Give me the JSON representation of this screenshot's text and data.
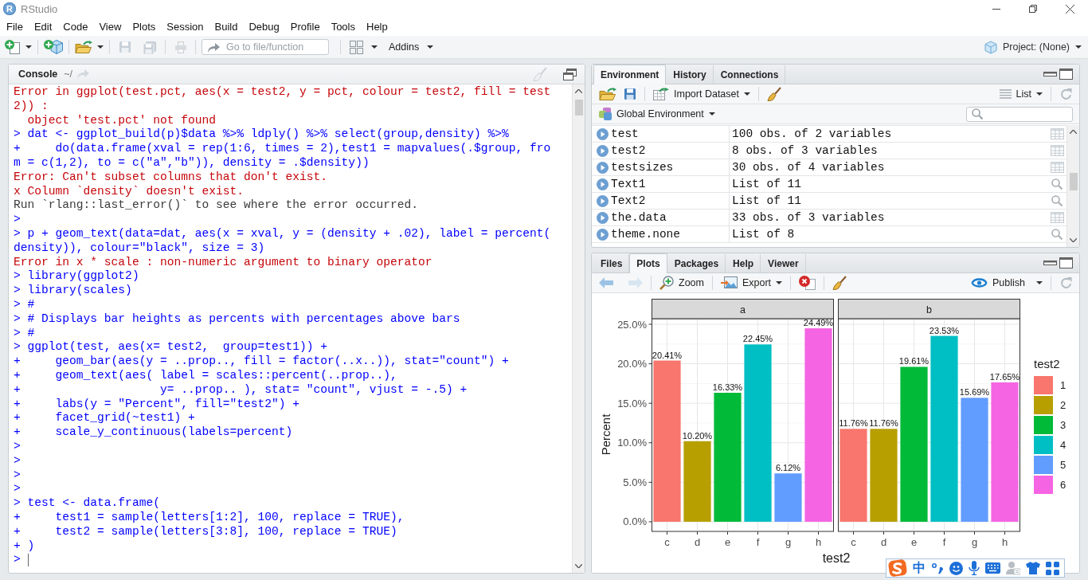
{
  "window": {
    "icon_letter": "R",
    "title": "RStudio"
  },
  "menu": [
    "File",
    "Edit",
    "Code",
    "View",
    "Plots",
    "Session",
    "Build",
    "Debug",
    "Profile",
    "Tools",
    "Help"
  ],
  "toolbar": {
    "go_to": {
      "placeholder": "Go to file/function"
    },
    "addins": "Addins",
    "project": "Project: (None)"
  },
  "console": {
    "title": "Console",
    "path": "~/",
    "lines": [
      {
        "kind": "error",
        "text": "Error in ggplot(test.pct, aes(x = test2, y = pct, colour = test2, fill = test"
      },
      {
        "kind": "error",
        "text": "2)) :"
      },
      {
        "kind": "error",
        "text": "  object 'test.pct' not found"
      },
      {
        "kind": "input",
        "text": "> dat <- ggplot_build(p)$data %>% ldply() %>% select(group,density) %>%"
      },
      {
        "kind": "input",
        "text": "+     do(data.frame(xval = rep(1:6, times = 2),test1 = mapvalues(.$group, fro"
      },
      {
        "kind": "input",
        "text": "m = c(1,2), to = c(\"a\",\"b\")), density = .$density))"
      },
      {
        "kind": "error",
        "text": "Error: Can't subset columns that don't exist."
      },
      {
        "kind": "error",
        "text": "x Column `density` doesn't exist."
      },
      {
        "kind": "output",
        "text": "Run `rlang::last_error()` to see where the error occurred."
      },
      {
        "kind": "input",
        "text": ">"
      },
      {
        "kind": "input",
        "text": "> p + geom_text(data=dat, aes(x = xval, y = (density + .02), label = percent("
      },
      {
        "kind": "input",
        "text": "density)), colour=\"black\", size = 3)"
      },
      {
        "kind": "error",
        "text": "Error in x * scale : non-numeric argument to binary operator"
      },
      {
        "kind": "input",
        "text": "> library(ggplot2)"
      },
      {
        "kind": "input",
        "text": "> library(scales)"
      },
      {
        "kind": "input",
        "text": "> #"
      },
      {
        "kind": "input",
        "text": "> # Displays bar heights as percents with percentages above bars"
      },
      {
        "kind": "input",
        "text": "> #"
      },
      {
        "kind": "input",
        "text": "> ggplot(test, aes(x= test2,  group=test1)) +"
      },
      {
        "kind": "input",
        "text": "+     geom_bar(aes(y = ..prop.., fill = factor(..x..)), stat=\"count\") +"
      },
      {
        "kind": "input",
        "text": "+     geom_text(aes( label = scales::percent(..prop..),"
      },
      {
        "kind": "input",
        "text": "+                    y= ..prop.. ), stat= \"count\", vjust = -.5) +"
      },
      {
        "kind": "input",
        "text": "+     labs(y = \"Percent\", fill=\"test2\") +"
      },
      {
        "kind": "input",
        "text": "+     facet_grid(~test1) +"
      },
      {
        "kind": "input",
        "text": "+     scale_y_continuous(labels=percent)"
      },
      {
        "kind": "input",
        "text": ">"
      },
      {
        "kind": "input",
        "text": ">"
      },
      {
        "kind": "input",
        "text": ">"
      },
      {
        "kind": "input",
        "text": ">"
      },
      {
        "kind": "input",
        "text": "> test <- data.frame("
      },
      {
        "kind": "input",
        "text": "+     test1 = sample(letters[1:2], 100, replace = TRUE),"
      },
      {
        "kind": "input",
        "text": "+     test2 = sample(letters[3:8], 100, replace = TRUE)"
      },
      {
        "kind": "input",
        "text": "+ )"
      }
    ],
    "prompt": ">"
  },
  "environment_pane": {
    "tabs": [
      {
        "label": "Environment",
        "selected": true
      },
      {
        "label": "History",
        "selected": false
      },
      {
        "label": "Connections",
        "selected": false
      }
    ],
    "import_dataset": "Import Dataset",
    "view": "List",
    "scope": "Global Environment",
    "rows": [
      {
        "name": "test",
        "value": "100 obs. of 2 variables",
        "kind": "data"
      },
      {
        "name": "test2",
        "value": "8 obs. of 3 variables",
        "kind": "data"
      },
      {
        "name": "testsizes",
        "value": "30 obs. of 4 variables",
        "kind": "data"
      },
      {
        "name": "Text1",
        "value": "List of 11",
        "kind": "list"
      },
      {
        "name": "Text2",
        "value": "List of 11",
        "kind": "list"
      },
      {
        "name": "the.data",
        "value": "33 obs. of 3 variables",
        "kind": "data"
      },
      {
        "name": "theme.none",
        "value": "List of 8",
        "kind": "list"
      }
    ]
  },
  "plots_pane": {
    "tabs": [
      {
        "label": "Files",
        "selected": false
      },
      {
        "label": "Plots",
        "selected": true
      },
      {
        "label": "Packages",
        "selected": false
      },
      {
        "label": "Help",
        "selected": false
      },
      {
        "label": "Viewer",
        "selected": false
      }
    ],
    "zoom": "Zoom",
    "export": "Export",
    "publish": "Publish",
    "plot": {
      "ylabel": "Percent",
      "xlabel": "test2",
      "chart_data": [
        {
          "type": "bar",
          "title": "a",
          "categories": [
            "c",
            "d",
            "e",
            "f",
            "g",
            "h"
          ],
          "values": [
            20.41,
            10.2,
            16.33,
            22.45,
            6.12,
            24.49
          ],
          "value_labels": [
            "20.41%",
            "10.20%",
            "16.33%",
            "22.45%",
            "6.12%",
            "24.49%"
          ],
          "colors": [
            "#f8766d",
            "#b79f00",
            "#00ba38",
            "#00bfc4",
            "#619cff",
            "#f564e3"
          ],
          "ylim": [
            -1.22,
            25.71
          ],
          "yticks": [
            {
              "value": 0,
              "label": "0.0%"
            },
            {
              "value": 5,
              "label": "5.0%"
            },
            {
              "value": 10,
              "label": "10.0%"
            },
            {
              "value": 15,
              "label": "15.0%"
            },
            {
              "value": 20,
              "label": "20.0%"
            },
            {
              "value": 25,
              "label": "25.0%"
            }
          ],
          "grid": true
        },
        {
          "type": "bar",
          "title": "b",
          "categories": [
            "c",
            "d",
            "e",
            "f",
            "g",
            "h"
          ],
          "values": [
            11.76,
            11.76,
            19.61,
            23.53,
            15.69,
            17.65
          ],
          "value_labels": [
            "11.76%",
            "11.76%",
            "19.61%",
            "23.53%",
            "15.69%",
            "17.65%"
          ],
          "colors": [
            "#f8766d",
            "#b79f00",
            "#00ba38",
            "#00bfc4",
            "#619cff",
            "#f564e3"
          ],
          "ylim": [
            -1.22,
            25.71
          ],
          "yticks": [
            0,
            5,
            10,
            15,
            20,
            25
          ],
          "tick_labels": "x",
          "grid": true
        }
      ],
      "legend": {
        "title": "test2",
        "items": [
          {
            "label": "1",
            "color": "#f8766d"
          },
          {
            "label": "2",
            "color": "#b79f00"
          },
          {
            "label": "3",
            "color": "#00ba38"
          },
          {
            "label": "4",
            "color": "#00bfc4"
          },
          {
            "label": "5",
            "color": "#619cff"
          },
          {
            "label": "6",
            "color": "#f564e3"
          }
        ]
      }
    }
  },
  "ime_toolbar": {
    "mode": "中"
  }
}
